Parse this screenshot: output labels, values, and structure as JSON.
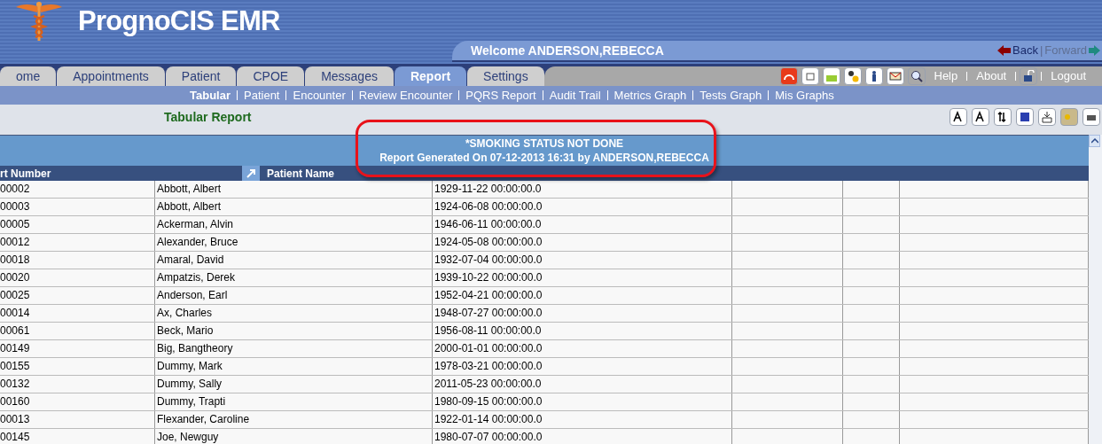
{
  "app": {
    "title": "PrognoCIS EMR",
    "welcome": "Welcome ANDERSON,REBECCA",
    "back": "Back",
    "separator": "|",
    "forward": "Forward",
    "forward_disabled": true
  },
  "tabs": [
    {
      "label": "ome",
      "selected": false
    },
    {
      "label": "Appointments",
      "selected": false
    },
    {
      "label": "Patient",
      "selected": false
    },
    {
      "label": "CPOE",
      "selected": false
    },
    {
      "label": "Messages",
      "selected": false
    },
    {
      "label": "Report",
      "selected": true
    },
    {
      "label": "Settings",
      "selected": false
    }
  ],
  "toolbar_links": [
    "Help",
    "About",
    "Logout"
  ],
  "subnav": [
    {
      "label": "Tabular",
      "selected": true
    },
    {
      "label": "Patient",
      "selected": false
    },
    {
      "label": "Encounter",
      "selected": false
    },
    {
      "label": "Review Encounter",
      "selected": false
    },
    {
      "label": "PQRS Report",
      "selected": false
    },
    {
      "label": "Audit Trail",
      "selected": false
    },
    {
      "label": "Metrics Graph",
      "selected": false
    },
    {
      "label": "Tests Graph",
      "selected": false
    },
    {
      "label": "Mis Graphs",
      "selected": false
    }
  ],
  "report": {
    "title": "Tabular Report",
    "banner": [
      "*SMOKING STATUS NOT DONE",
      "Report Generated On 07-12-2013 16:31 by ANDERSON,REBECCA"
    ],
    "annotated": true
  },
  "table": {
    "columns": [
      "rt Number",
      "Patient Name"
    ],
    "rows": [
      [
        "00002",
        "Abbott, Albert",
        "1929-11-22 00:00:00.0"
      ],
      [
        "00003",
        "Abbott, Albert",
        "1924-06-08 00:00:00.0"
      ],
      [
        "00005",
        "Ackerman, Alvin",
        "1946-06-11 00:00:00.0"
      ],
      [
        "00012",
        "Alexander, Bruce",
        "1924-05-08 00:00:00.0"
      ],
      [
        "00018",
        "Amaral, David",
        "1932-07-04 00:00:00.0"
      ],
      [
        "00020",
        "Ampatzis, Derek",
        "1939-10-22 00:00:00.0"
      ],
      [
        "00025",
        "Anderson, Earl",
        "1952-04-21 00:00:00.0"
      ],
      [
        "00014",
        "Ax, Charles",
        "1948-07-27 00:00:00.0"
      ],
      [
        "00061",
        "Beck, Mario",
        "1956-08-11 00:00:00.0"
      ],
      [
        "00149",
        "Big, Bangtheory",
        "2000-01-01 00:00:00.0"
      ],
      [
        "00155",
        "Dummy, Mark",
        "1978-03-21 00:00:00.0"
      ],
      [
        "00132",
        "Dummy, Sally",
        "2011-05-23 00:00:00.0"
      ],
      [
        "00160",
        "Dummy, Trapti",
        "1980-09-15 00:00:00.0"
      ],
      [
        "00013",
        "Flexander, Caroline",
        "1922-01-14 00:00:00.0"
      ],
      [
        "00145",
        "Joe, Newguy",
        "1980-07-07 00:00:00.0"
      ]
    ]
  }
}
